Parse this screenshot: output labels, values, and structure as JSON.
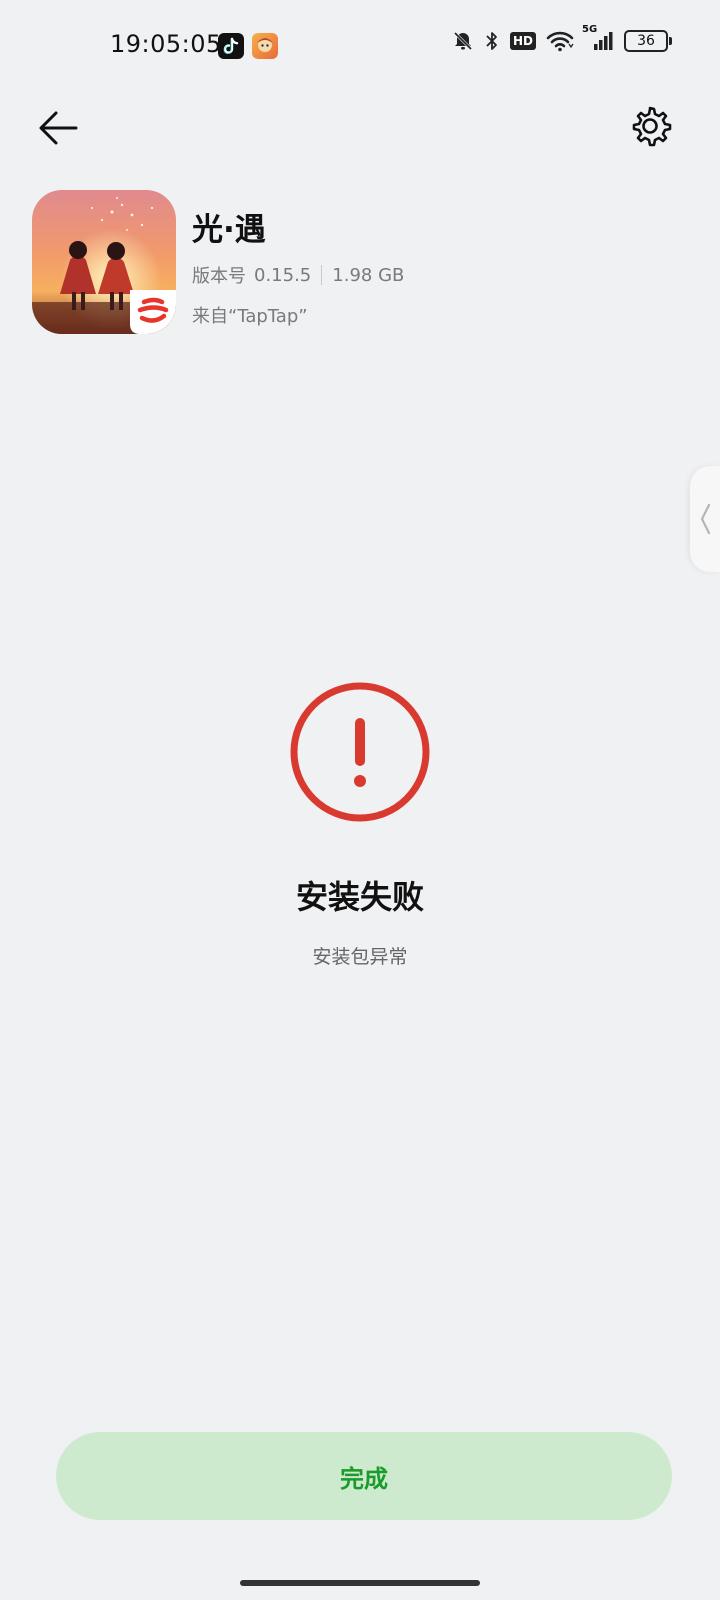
{
  "status_bar": {
    "time": "19:05:05",
    "network_label": "5G",
    "hd_label": "HD",
    "battery_level": "36",
    "icons": [
      "tiktok-icon",
      "game-app-icon",
      "bell-off-icon",
      "bluetooth-icon",
      "hd-icon",
      "wifi-icon",
      "signal-icon",
      "battery-icon"
    ]
  },
  "nav": {
    "back_icon": "arrow-left-icon",
    "settings_icon": "gear-icon"
  },
  "app": {
    "name": "光·遇",
    "version_label": "版本号",
    "version": "0.15.5",
    "size": "1.98 GB",
    "source_text": "来自“TapTap”"
  },
  "result": {
    "title": "安装失败",
    "detail": "安装包异常",
    "icon": "error-exclamation-icon",
    "icon_color": "#d93a30"
  },
  "actions": {
    "done_label": "完成",
    "done_bg": "#cdeacf",
    "done_text_color": "#1a9b2b"
  }
}
